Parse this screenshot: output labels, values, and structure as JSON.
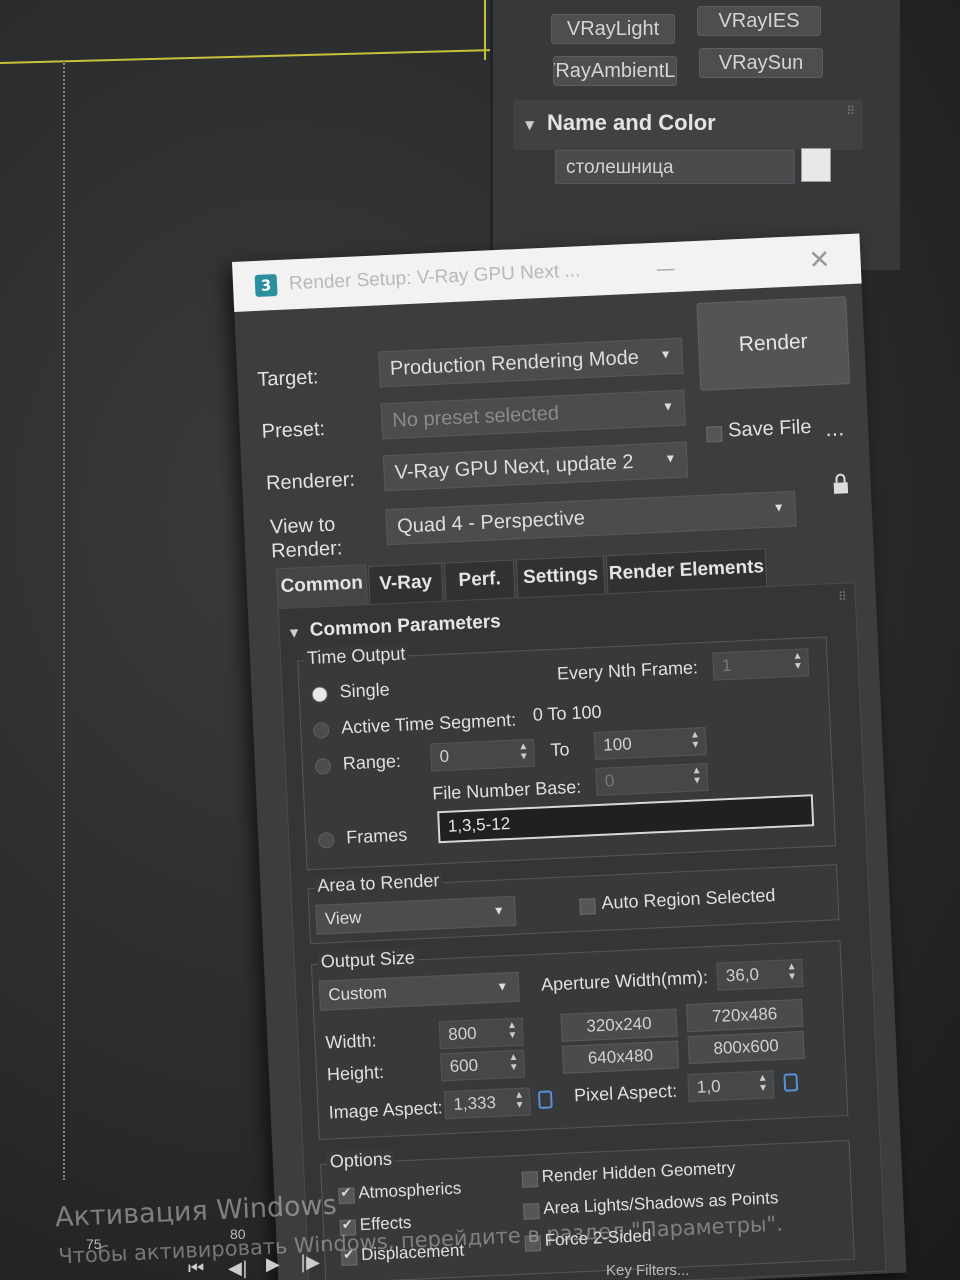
{
  "command_panel": {
    "buttons": [
      "VRayLight",
      "VRayIES",
      "VRayAmbientLight",
      "VRaySun"
    ],
    "name_color_title": "Name and Color",
    "object_name": "столешница",
    "object_color": "#e8e8e8"
  },
  "dialog": {
    "title": "Render Setup: V-Ray GPU Next ...",
    "app_icon": "3",
    "target_label": "Target:",
    "target_value": "Production Rendering Mode",
    "preset_label": "Preset:",
    "preset_value": "No preset selected",
    "renderer_label": "Renderer:",
    "renderer_value": "V-Ray GPU Next, update 2",
    "view_label_1": "View to",
    "view_label_2": "Render:",
    "view_value": "Quad 4 - Perspective",
    "render_button": "Render",
    "save_file_label": "Save File",
    "more_button": "...",
    "tabs": [
      "Common",
      "V-Ray",
      "Perf.",
      "Settings",
      "Render Elements"
    ],
    "active_tab": "Common"
  },
  "common_parameters": {
    "header": "Common Parameters",
    "time_output": {
      "title": "Time Output",
      "single": "Single",
      "every_nth_label": "Every Nth Frame:",
      "every_nth_value": "1",
      "active_segment_label": "Active Time Segment:",
      "active_segment_value": "0 To 100",
      "range_label": "Range:",
      "range_from": "0",
      "range_to_label": "To",
      "range_to": "100",
      "file_number_base_label": "File Number Base:",
      "file_number_base": "0",
      "frames_label": "Frames",
      "frames_value": "1,3,5-12"
    },
    "area_to_render": {
      "title": "Area to Render",
      "value": "View",
      "auto_region_label": "Auto Region Selected"
    },
    "output_size": {
      "title": "Output Size",
      "preset": "Custom",
      "aperture_label": "Aperture Width(mm):",
      "aperture_value": "36,0",
      "width_label": "Width:",
      "width_value": "800",
      "height_label": "Height:",
      "height_value": "600",
      "presets": [
        "320x240",
        "720x486",
        "640x480",
        "800x600"
      ],
      "image_aspect_label": "Image Aspect:",
      "image_aspect_value": "1,333",
      "pixel_aspect_label": "Pixel Aspect:",
      "pixel_aspect_value": "1,0"
    },
    "options": {
      "title": "Options",
      "atmospherics": "Atmospherics",
      "effects": "Effects",
      "displacement": "Displacement",
      "render_hidden": "Render Hidden Geometry",
      "area_lights": "Area Lights/Shadows as Points",
      "force_2sided": "Force 2-Sided"
    }
  },
  "watermark": {
    "line1": "Активация Windows",
    "line2": "Чтобы активировать Windows, перейдите в раздел \"Параметры\"."
  },
  "timeline": {
    "ticks": [
      "75",
      "80"
    ],
    "key_filters": "Key Filters..."
  }
}
